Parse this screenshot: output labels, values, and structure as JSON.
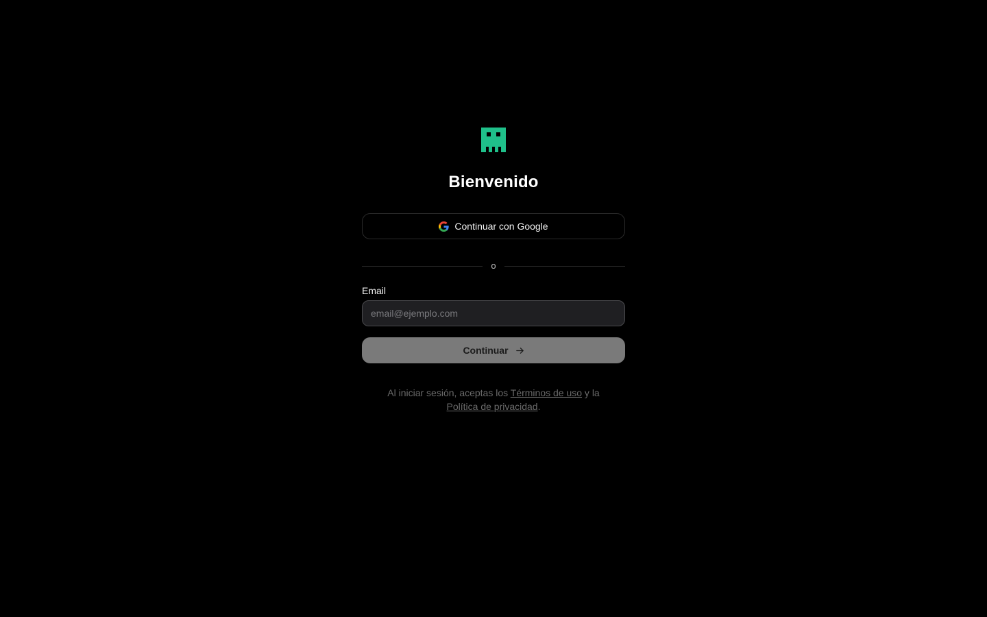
{
  "colors": {
    "background": "#000000",
    "accent": "#1fc08a",
    "continue_button": "#7a7a7a"
  },
  "logo": {
    "icon": "pixel-face-logo-icon"
  },
  "title": "Bienvenido",
  "google_button": {
    "icon": "google-icon",
    "label": "Continuar con Google"
  },
  "divider": {
    "text": "o"
  },
  "email": {
    "label": "Email",
    "placeholder": "email@ejemplo.com",
    "value": ""
  },
  "continue_button": {
    "label": "Continuar",
    "icon": "arrow-right-icon"
  },
  "legal": {
    "prefix": "Al iniciar sesión, aceptas los ",
    "terms_link": "Términos de uso",
    "middle": " y la",
    "privacy_link": "Política de privacidad",
    "suffix": "."
  }
}
